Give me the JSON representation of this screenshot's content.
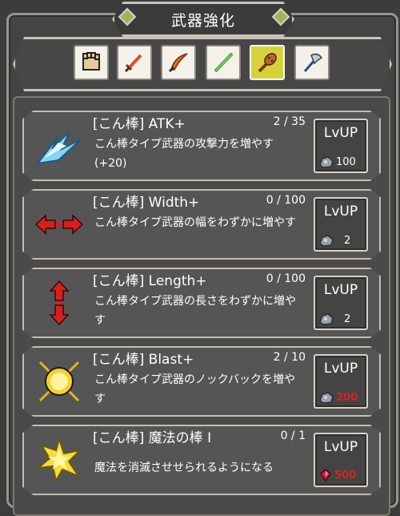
{
  "title": "武器強化",
  "tabs": [
    {
      "icon": "glove-icon",
      "active": false
    },
    {
      "icon": "sword-icon",
      "active": false
    },
    {
      "icon": "scimitar-icon",
      "active": false
    },
    {
      "icon": "staff-icon",
      "active": false
    },
    {
      "icon": "club-icon",
      "active": true
    },
    {
      "icon": "axe-icon",
      "active": false
    }
  ],
  "upgrades": [
    {
      "title": "[こん棒] ATK+",
      "count": "2 / 35",
      "desc": "こん棒タイプ武器の攻撃力を増やす(+20)",
      "button": "LvUP",
      "cost": "100",
      "cost_icon": "ore-icon",
      "affordable": true
    },
    {
      "title": "[こん棒] Width+",
      "count": "0 / 100",
      "desc": "こん棒タイプ武器の幅をわずかに増やす",
      "button": "LvUP",
      "cost": "2",
      "cost_icon": "ore-icon",
      "affordable": true
    },
    {
      "title": "[こん棒] Length+",
      "count": "0 / 100",
      "desc": "こん棒タイプ武器の長さをわずかに増やす",
      "button": "LvUP",
      "cost": "2",
      "cost_icon": "ore-icon",
      "affordable": true
    },
    {
      "title": "[こん棒] Blast+",
      "count": "2 / 10",
      "desc": "こん棒タイプ武器のノックバックを増やす",
      "button": "LvUP",
      "cost": "200",
      "cost_icon": "ore-icon",
      "affordable": false
    },
    {
      "title": "[こん棒] 魔法の棒 I",
      "count": "0 / 1",
      "desc": "魔法を消滅させせられるようになる",
      "button": "LvUP",
      "cost": "500",
      "cost_icon": "gem-icon",
      "affordable": false
    }
  ],
  "colors": {
    "accent_tab": "#d9d13a",
    "cost_insufficient": "#d8202a",
    "frame": "#c4bdb1"
  }
}
